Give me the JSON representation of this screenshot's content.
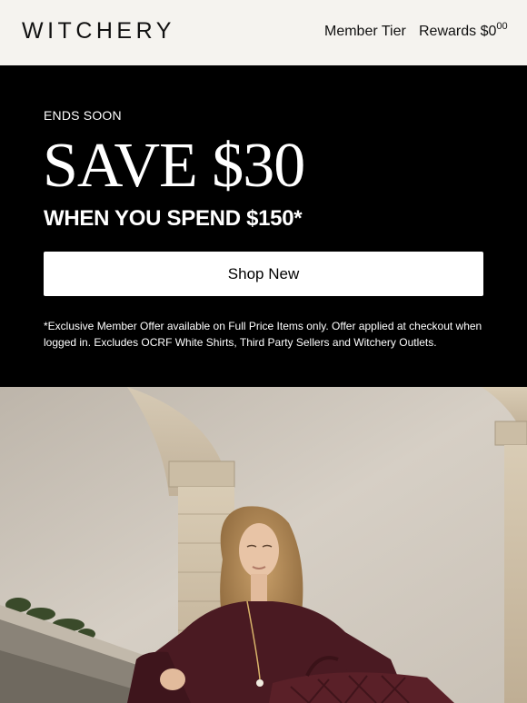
{
  "header": {
    "logo": "WITCHERY",
    "member_tier": "Member Tier",
    "rewards_label": "Rewards $0",
    "rewards_cents": "00"
  },
  "promo": {
    "eyebrow": "ENDS SOON",
    "headline": "SAVE $30",
    "subhead": "WHEN YOU SPEND $150*",
    "cta": "Shop New",
    "disclaimer": "*Exclusive Member Offer available on Full Price Items only. Offer applied at checkout when logged in. Excludes OCRF White Shirts, Third Party Sellers and Witchery Outlets."
  },
  "colors": {
    "header_bg": "#f5f3ef",
    "promo_bg": "#000000",
    "cta_bg": "#ffffff"
  }
}
